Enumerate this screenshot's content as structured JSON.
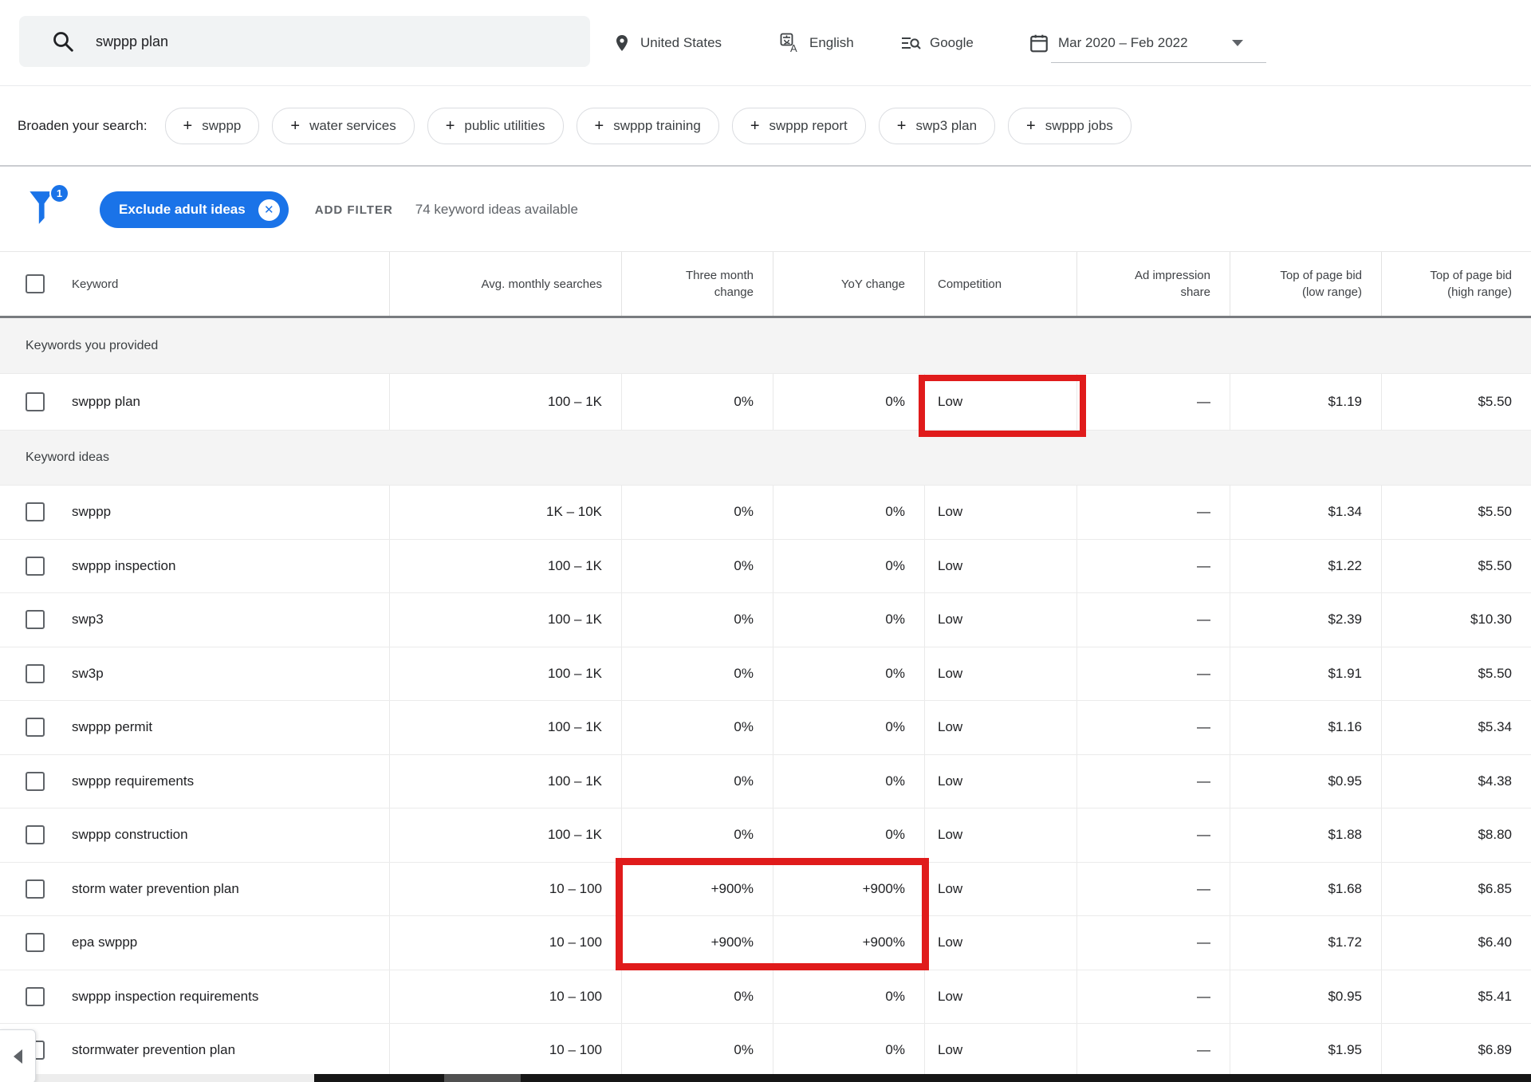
{
  "topbar": {
    "search_value": "swppp plan",
    "location": "United States",
    "language": "English",
    "network": "Google",
    "date_range": "Mar 2020 – Feb 2022"
  },
  "broaden": {
    "label": "Broaden your search:",
    "chips": [
      "swppp",
      "water services",
      "public utilities",
      "swppp training",
      "swppp report",
      "swp3 plan",
      "swppp jobs"
    ]
  },
  "filterbar": {
    "filter_count": "1",
    "chip_label": "Exclude adult ideas",
    "add_filter": "ADD FILTER",
    "ideas_available": "74 keyword ideas available"
  },
  "icons": {
    "plus": "+",
    "close": "✕"
  },
  "colors": {
    "accent_blue": "#1a73e8",
    "annotation_red": "#e01b1b",
    "band_gray": "#f4f4f4"
  },
  "table": {
    "columns": [
      "Keyword",
      "Avg. monthly searches",
      "Three month\nchange",
      "YoY change",
      "Competition",
      "Ad impression\nshare",
      "Top of page bid\n(low range)",
      "Top of page bid\n(high range)"
    ],
    "sections": [
      {
        "label": "Keywords you provided",
        "rows": [
          {
            "keyword": "swppp plan",
            "avg": "100 – 1K",
            "three_month": "0%",
            "yoy": "0%",
            "competition": "Low",
            "ad_share": "—",
            "bid_low": "$1.19",
            "bid_high": "$5.50"
          }
        ]
      },
      {
        "label": "Keyword ideas",
        "rows": [
          {
            "keyword": "swppp",
            "avg": "1K – 10K",
            "three_month": "0%",
            "yoy": "0%",
            "competition": "Low",
            "ad_share": "—",
            "bid_low": "$1.34",
            "bid_high": "$5.50"
          },
          {
            "keyword": "swppp inspection",
            "avg": "100 – 1K",
            "three_month": "0%",
            "yoy": "0%",
            "competition": "Low",
            "ad_share": "—",
            "bid_low": "$1.22",
            "bid_high": "$5.50"
          },
          {
            "keyword": "swp3",
            "avg": "100 – 1K",
            "three_month": "0%",
            "yoy": "0%",
            "competition": "Low",
            "ad_share": "—",
            "bid_low": "$2.39",
            "bid_high": "$10.30"
          },
          {
            "keyword": "sw3p",
            "avg": "100 – 1K",
            "three_month": "0%",
            "yoy": "0%",
            "competition": "Low",
            "ad_share": "—",
            "bid_low": "$1.91",
            "bid_high": "$5.50"
          },
          {
            "keyword": "swppp permit",
            "avg": "100 – 1K",
            "three_month": "0%",
            "yoy": "0%",
            "competition": "Low",
            "ad_share": "—",
            "bid_low": "$1.16",
            "bid_high": "$5.34"
          },
          {
            "keyword": "swppp requirements",
            "avg": "100 – 1K",
            "three_month": "0%",
            "yoy": "0%",
            "competition": "Low",
            "ad_share": "—",
            "bid_low": "$0.95",
            "bid_high": "$4.38"
          },
          {
            "keyword": "swppp construction",
            "avg": "100 – 1K",
            "three_month": "0%",
            "yoy": "0%",
            "competition": "Low",
            "ad_share": "—",
            "bid_low": "$1.88",
            "bid_high": "$8.80"
          },
          {
            "keyword": "storm water prevention plan",
            "avg": "10 – 100",
            "three_month": "+900%",
            "yoy": "+900%",
            "competition": "Low",
            "ad_share": "—",
            "bid_low": "$1.68",
            "bid_high": "$6.85"
          },
          {
            "keyword": "epa swppp",
            "avg": "10 – 100",
            "three_month": "+900%",
            "yoy": "+900%",
            "competition": "Low",
            "ad_share": "—",
            "bid_low": "$1.72",
            "bid_high": "$6.40"
          },
          {
            "keyword": "swppp inspection requirements",
            "avg": "10 – 100",
            "three_month": "0%",
            "yoy": "0%",
            "competition": "Low",
            "ad_share": "—",
            "bid_low": "$0.95",
            "bid_high": "$5.41"
          },
          {
            "keyword": "stormwater prevention plan",
            "avg": "10 – 100",
            "three_month": "0%",
            "yoy": "0%",
            "competition": "Low",
            "ad_share": "—",
            "bid_low": "$1.95",
            "bid_high": "$6.89"
          }
        ]
      }
    ]
  }
}
